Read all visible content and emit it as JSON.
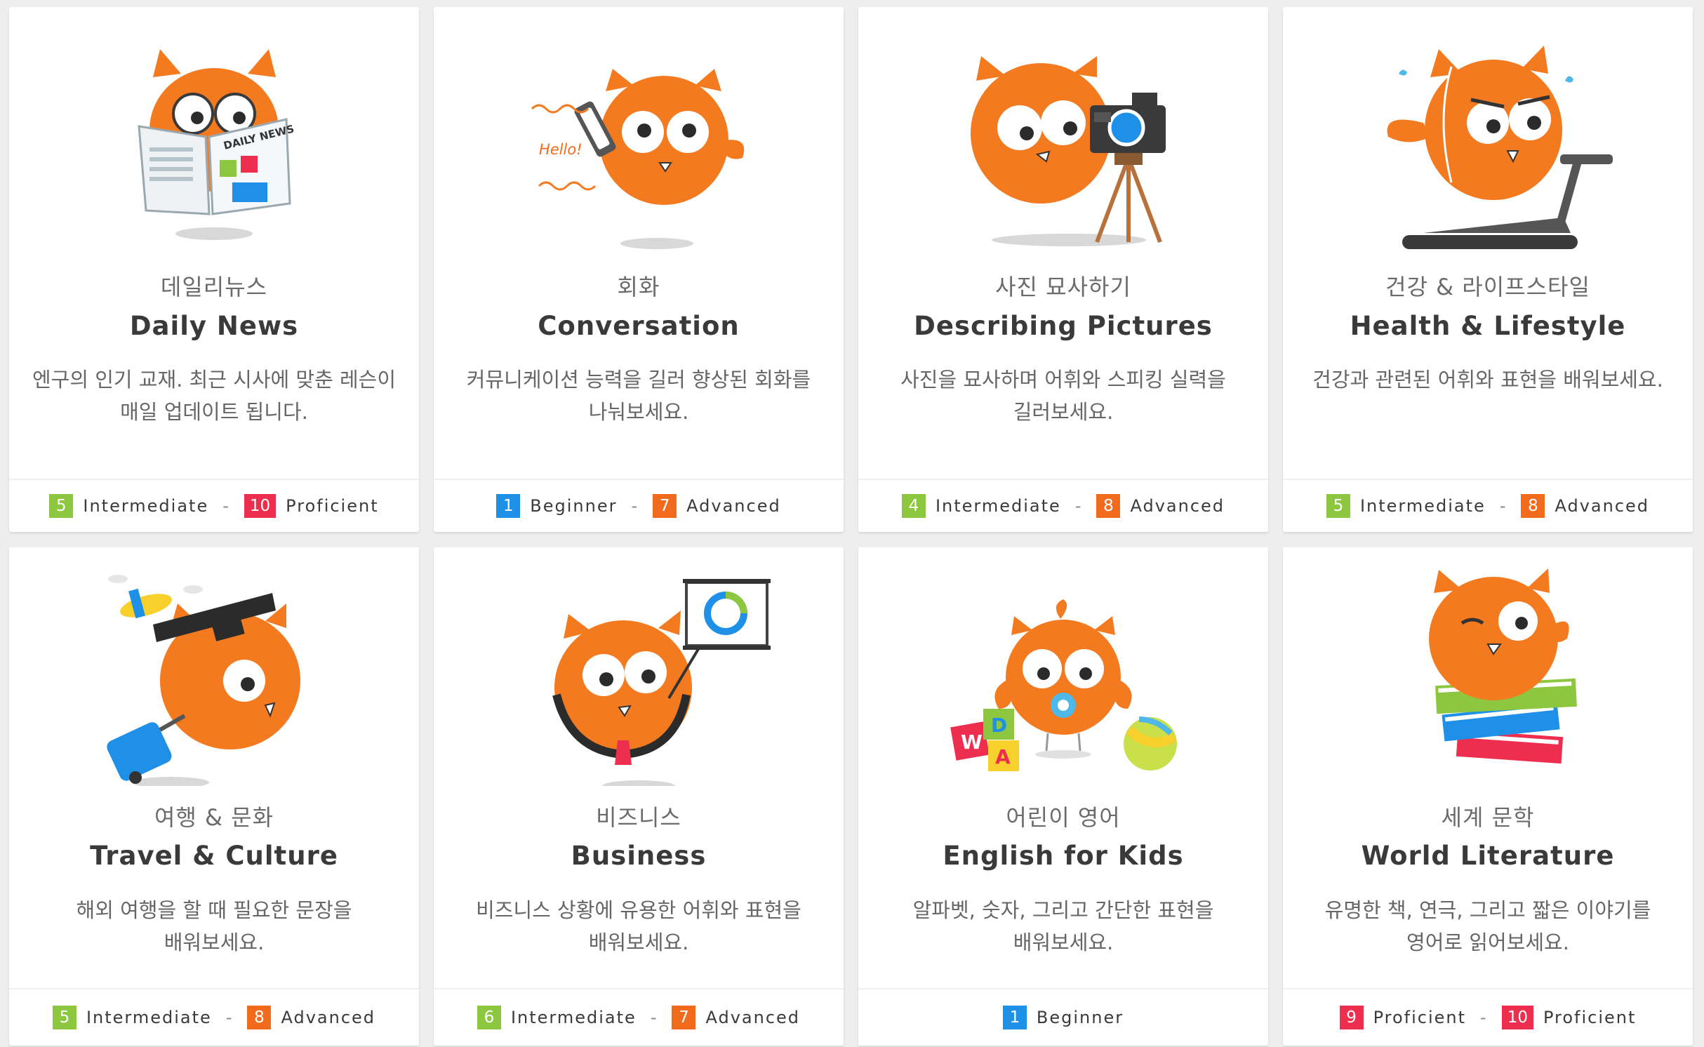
{
  "colors": {
    "owl_orange": "#f47a20",
    "beginner": "#1e90e8",
    "intermediate": "#8dc63f",
    "advanced": "#f26b1d",
    "proficient": "#ee2e4f"
  },
  "cards": [
    {
      "title_ko": "데일리뉴스",
      "title_en": "Daily News",
      "description": "엔구의 인기 교재. 최근 시사에 맞춘 레슨이 매일 업데이트 됩니다.",
      "illustration": "owl-reading-newspaper-icon",
      "newspaper_text": "DAILY NEWS",
      "level_from": {
        "num": "5",
        "label": "Intermediate",
        "tier": "intermediate"
      },
      "level_to": {
        "num": "10",
        "label": "Proficient",
        "tier": "proficient"
      }
    },
    {
      "title_ko": "회화",
      "title_en": "Conversation",
      "description": "커뮤니케이션 능력을 길러 향상된 회화를 나눠보세요.",
      "illustration": "owl-on-phone-icon",
      "speech_text": "Hello!",
      "level_from": {
        "num": "1",
        "label": "Beginner",
        "tier": "beginner"
      },
      "level_to": {
        "num": "7",
        "label": "Advanced",
        "tier": "advanced"
      }
    },
    {
      "title_ko": "사진 묘사하기",
      "title_en": "Describing Pictures",
      "description": "사진을 묘사하며 어휘와 스피킹 실력을 길러보세요.",
      "illustration": "owl-with-camera-icon",
      "level_from": {
        "num": "4",
        "label": "Intermediate",
        "tier": "intermediate"
      },
      "level_to": {
        "num": "8",
        "label": "Advanced",
        "tier": "advanced"
      }
    },
    {
      "title_ko": "건강 & 라이프스타일",
      "title_en": "Health & Lifestyle",
      "description": "건강과 관련된 어휘와 표현을 배워보세요.",
      "illustration": "owl-on-treadmill-icon",
      "level_from": {
        "num": "5",
        "label": "Intermediate",
        "tier": "intermediate"
      },
      "level_to": {
        "num": "8",
        "label": "Advanced",
        "tier": "advanced"
      }
    },
    {
      "title_ko": "여행 & 문화",
      "title_en": "Travel & Culture",
      "description": "해외 여행을 할 때 필요한 문장을 배워보세요.",
      "illustration": "owl-traveler-icon",
      "level_from": {
        "num": "5",
        "label": "Intermediate",
        "tier": "intermediate"
      },
      "level_to": {
        "num": "8",
        "label": "Advanced",
        "tier": "advanced"
      }
    },
    {
      "title_ko": "비즈니스",
      "title_en": "Business",
      "description": "비즈니스 상황에 유용한 어휘와 표현을 배워보세요.",
      "illustration": "owl-presenting-chart-icon",
      "level_from": {
        "num": "6",
        "label": "Intermediate",
        "tier": "intermediate"
      },
      "level_to": {
        "num": "7",
        "label": "Advanced",
        "tier": "advanced"
      }
    },
    {
      "title_ko": "어린이 영어",
      "title_en": "English for Kids",
      "description": "알파벳, 숫자, 그리고 간단한 표현을 배워보세요.",
      "illustration": "baby-owl-with-blocks-icon",
      "blocks_text": [
        "W",
        "D",
        "A"
      ],
      "level_from": {
        "num": "1",
        "label": "Beginner",
        "tier": "beginner"
      },
      "level_to": null
    },
    {
      "title_ko": "세계 문학",
      "title_en": "World Literature",
      "description": "유명한 책, 연극, 그리고 짧은 이야기를 영어로 읽어보세요.",
      "illustration": "owl-on-books-icon",
      "level_from": {
        "num": "9",
        "label": "Proficient",
        "tier": "proficient"
      },
      "level_to": {
        "num": "10",
        "label": "Proficient",
        "tier": "proficient"
      }
    }
  ]
}
